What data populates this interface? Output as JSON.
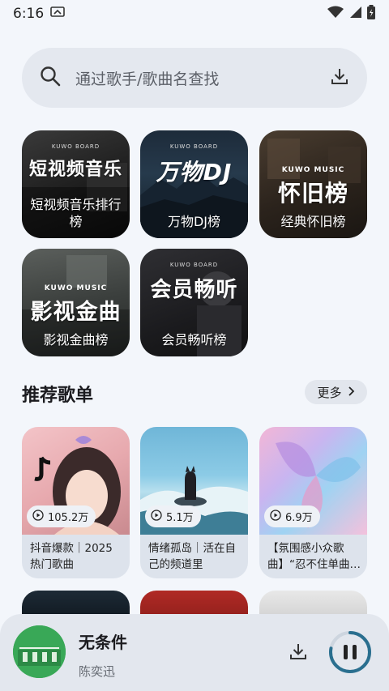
{
  "status_bar": {
    "time": "6:16"
  },
  "search": {
    "placeholder": "通过歌手/歌曲名查找"
  },
  "ranks": [
    {
      "art_text": "短视频音乐",
      "label": "短视频音乐排行榜"
    },
    {
      "art_text": "万物DJ",
      "label": "万物DJ榜"
    },
    {
      "art_text": "怀旧榜",
      "label": "经典怀旧榜"
    },
    {
      "art_text": "影视金曲",
      "label": "影视金曲榜"
    },
    {
      "art_text": "会员畅听",
      "label": "会员畅听榜"
    }
  ],
  "rank_badges": [
    "KUWO BOARD",
    "KUWO BOARD",
    "KUWO MUSIC",
    "KUWO MUSIC",
    "KUWO BOARD"
  ],
  "section": {
    "title": "推荐歌单",
    "more_label": "更多"
  },
  "playlists": [
    {
      "count": "105.2万",
      "title": "抖音爆款｜2025热门歌曲"
    },
    {
      "count": "5.1万",
      "title": "情绪孤岛｜活在自己的频道里"
    },
    {
      "count": "6.9万",
      "title": "【氛围感小众歌曲】“忍不住单曲…"
    }
  ],
  "player": {
    "song": "无条件",
    "artist": "陈奕迅",
    "progress": 0.78
  },
  "colors": {
    "accent": "#2a6f8f",
    "background": "#f3f6fb"
  }
}
